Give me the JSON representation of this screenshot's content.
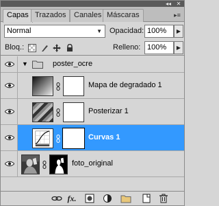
{
  "tabs": [
    {
      "label": "Capas",
      "active": true
    },
    {
      "label": "Trazados",
      "active": false
    },
    {
      "label": "Canales",
      "active": false
    },
    {
      "label": "Máscaras",
      "active": false
    }
  ],
  "blend": {
    "mode": "Normal"
  },
  "opacity": {
    "label": "Opacidad:",
    "value": "100%"
  },
  "lock": {
    "label": "Bloq.:"
  },
  "fill": {
    "label": "Relleno:",
    "value": "100%"
  },
  "layers": {
    "group": {
      "name": "poster_ocre"
    },
    "gradient_map": {
      "name": "Mapa de degradado 1"
    },
    "posterize": {
      "name": "Posterizar 1"
    },
    "curves": {
      "name": "Curvas 1",
      "selected": true
    },
    "photo": {
      "name": "foto_original"
    }
  },
  "bottom_toolbar": {
    "fx_label": "fx."
  },
  "colors": {
    "selection": "#3399ff",
    "panel_bg": "#d6d6d6",
    "title_bar": "#5a5a5a"
  },
  "icons": [
    "eye-icon",
    "folder-icon",
    "chain-icon",
    "link-layers-icon",
    "fx-icon",
    "mask-icon",
    "adjustment-icon",
    "new-group-icon",
    "new-layer-icon",
    "trash-icon"
  ]
}
